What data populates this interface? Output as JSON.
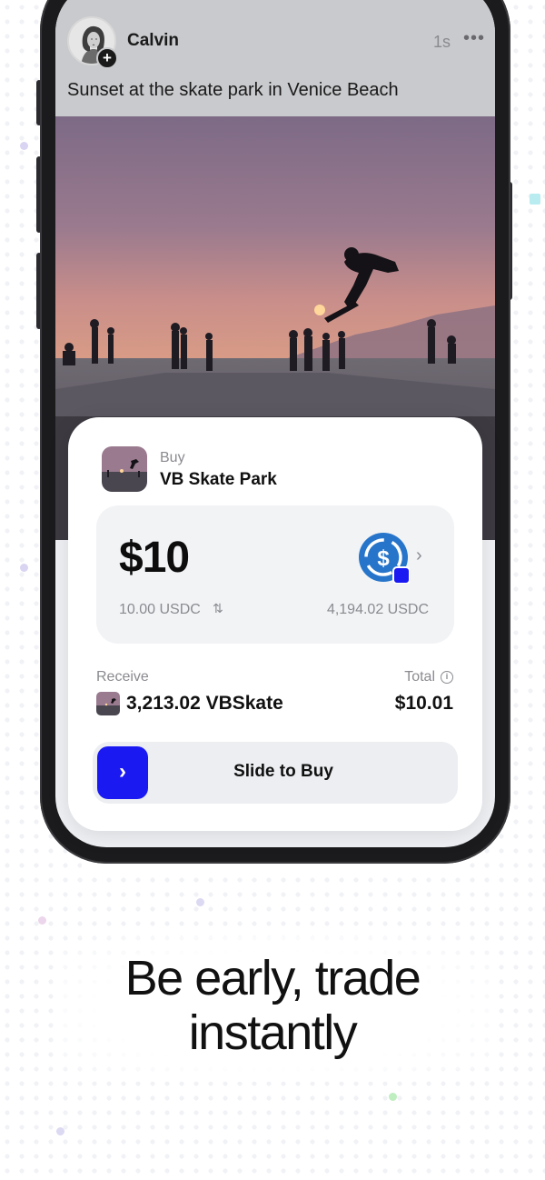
{
  "post": {
    "username": "Calvin",
    "time": "1s",
    "more_icon": "more-horizontal-icon",
    "caption": "Sunset at the skate park in Venice Beach"
  },
  "buy_sheet": {
    "buy_label": "Buy",
    "token_name": "VB Skate Park",
    "amount": "$10",
    "usdc_amount": "10.00 USDC",
    "usdc_balance": "4,194.02 USDC",
    "receive_label": "Receive",
    "receive_amount": "3,213.02 VBSkate",
    "total_label": "Total",
    "total_amount": "$10.01",
    "slider_label": "Slide to Buy",
    "accent_color": "#1a19f2",
    "usdc_color": "#2775ca"
  },
  "headline": {
    "line1": "Be early, trade",
    "line2": "instantly"
  }
}
